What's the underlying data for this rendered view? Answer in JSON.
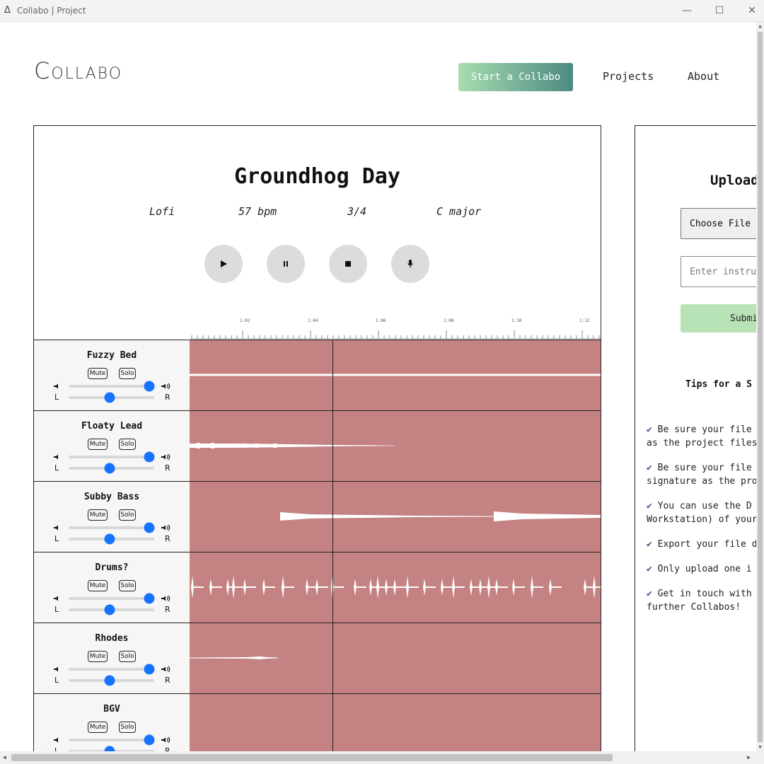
{
  "window": {
    "title": "Collabo | Project",
    "minimize": "—",
    "maximize": "☐",
    "close": "✕"
  },
  "header": {
    "logo": "Collabo",
    "start_button": "Start a Collabo",
    "nav": [
      "Projects",
      "About"
    ]
  },
  "project": {
    "title": "Groundhog Day",
    "genre": "Lofi",
    "tempo": "57 bpm",
    "time_signature": "3/4",
    "key": "C major",
    "transport": [
      {
        "name": "play-button",
        "icon": "play-icon"
      },
      {
        "name": "pause-button",
        "icon": "pause-icon"
      },
      {
        "name": "stop-button",
        "icon": "stop-icon"
      },
      {
        "name": "record-button",
        "icon": "microphone-icon"
      }
    ],
    "timeline_labels": [
      "1:02",
      "1:04",
      "1:06",
      "1:08",
      "1:10",
      "1:12"
    ],
    "tracks": [
      {
        "name": "Fuzzy Bed",
        "mute": "Mute",
        "solo": "Solo",
        "left": "L",
        "right": "R",
        "volume": 1.0,
        "pan": 0.5
      },
      {
        "name": "Floaty Lead",
        "mute": "Mute",
        "solo": "Solo",
        "left": "L",
        "right": "R",
        "volume": 1.0,
        "pan": 0.5
      },
      {
        "name": "Subby Bass",
        "mute": "Mute",
        "solo": "Solo",
        "left": "L",
        "right": "R",
        "volume": 1.0,
        "pan": 0.5
      },
      {
        "name": "Drums?",
        "mute": "Mute",
        "solo": "Solo",
        "left": "L",
        "right": "R",
        "volume": 1.0,
        "pan": 0.5
      },
      {
        "name": "Rhodes",
        "mute": "Mute",
        "solo": "Solo",
        "left": "L",
        "right": "R",
        "volume": 1.0,
        "pan": 0.5
      },
      {
        "name": "BGV",
        "mute": "Mute",
        "solo": "Solo",
        "left": "L",
        "right": "R",
        "volume": 1.0,
        "pan": 0.5
      }
    ]
  },
  "upload": {
    "title": "Upload",
    "choose_file": "Choose File",
    "instrument_placeholder": "Enter instru",
    "submit": "Submi",
    "tips_title": "Tips for a S",
    "tips": [
      "Be sure your file\nas the project files.",
      "Be sure your file\nsignature as the pro",
      "You can use the D\nWorkstation) of your",
      "Export your file d",
      "Only upload one i",
      "Get in touch with\nfurther Collabos!"
    ]
  },
  "colors": {
    "waveform_lane": "#c48282",
    "slider_thumb": "#1673ff",
    "start_gradient_from": "#a7ddb0",
    "start_gradient_to": "#4c8a82",
    "submit_bg": "#b7e3b6",
    "tip_check": "#4b4e8c"
  }
}
